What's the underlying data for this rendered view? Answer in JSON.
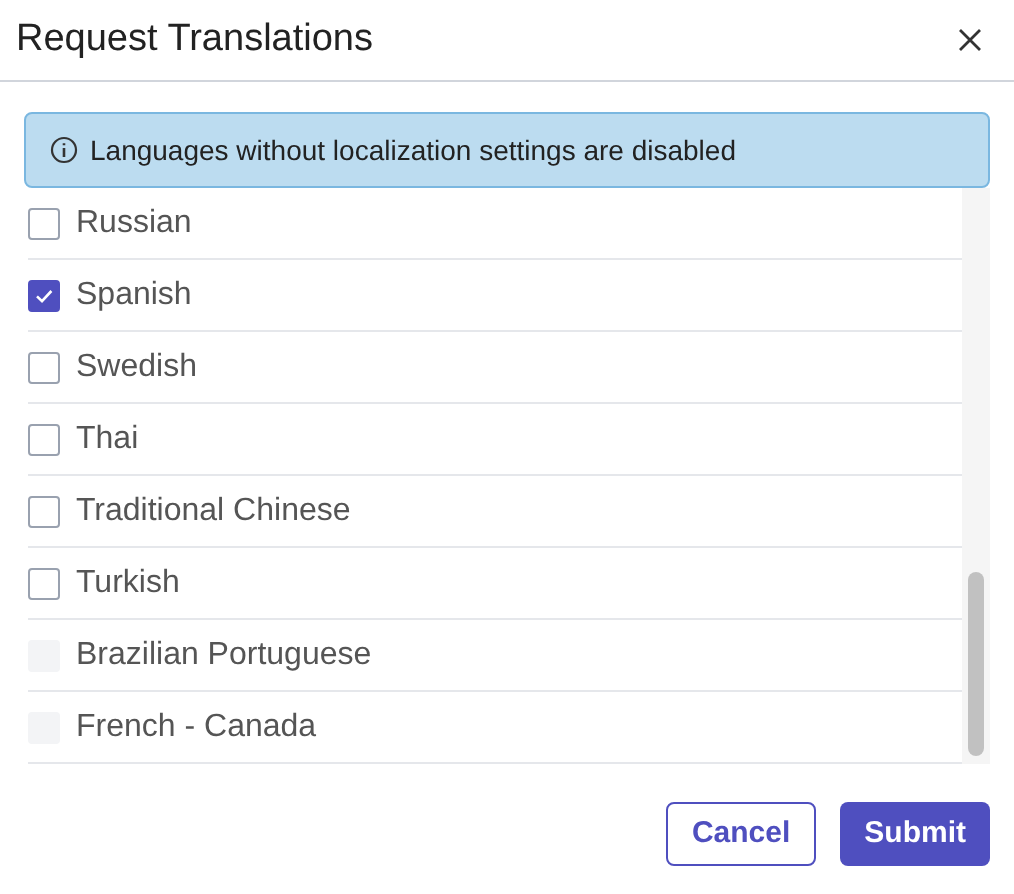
{
  "dialog": {
    "title": "Request Translations"
  },
  "notice": "Languages without localization settings are disabled",
  "languages": [
    {
      "label": "Russian",
      "checked": false,
      "disabled": false
    },
    {
      "label": "Spanish",
      "checked": true,
      "disabled": false
    },
    {
      "label": "Swedish",
      "checked": false,
      "disabled": false
    },
    {
      "label": "Thai",
      "checked": false,
      "disabled": false
    },
    {
      "label": "Traditional Chinese",
      "checked": false,
      "disabled": false
    },
    {
      "label": "Turkish",
      "checked": false,
      "disabled": false
    },
    {
      "label": "Brazilian Portuguese",
      "checked": false,
      "disabled": true
    },
    {
      "label": "French - Canada",
      "checked": false,
      "disabled": true
    }
  ],
  "buttons": {
    "cancel": "Cancel",
    "submit": "Submit"
  }
}
